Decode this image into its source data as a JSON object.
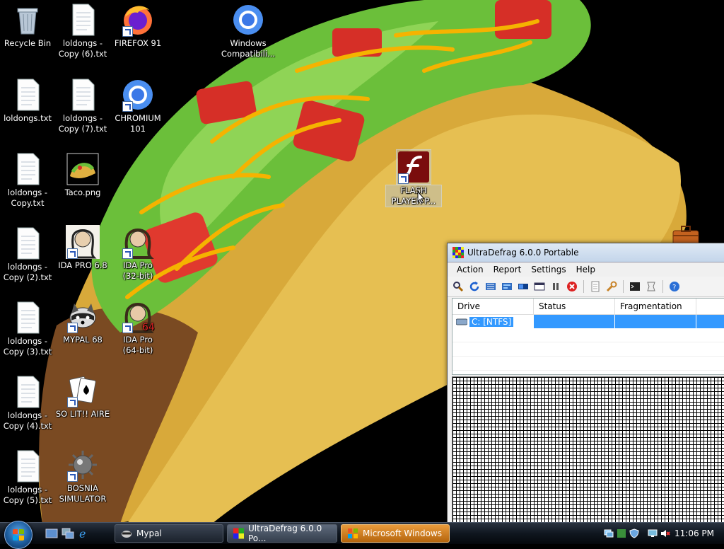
{
  "desktop": {
    "icons": [
      {
        "label": "Recycle Bin",
        "icon": "recycle-bin-icon"
      },
      {
        "label": "loldongs -\nCopy (6).txt",
        "icon": "text-file-icon"
      },
      {
        "label": "FIREFOX 91",
        "icon": "firefox-icon"
      },
      {
        "label": "Windows\nCompatibili...",
        "icon": "chromium-icon"
      },
      {
        "label": "loldongs.txt",
        "icon": "text-file-icon"
      },
      {
        "label": "loldongs -\nCopy (7).txt",
        "icon": "text-file-icon"
      },
      {
        "label": "CHROMIUM\n101",
        "icon": "chromium-icon"
      },
      {
        "label": "loldongs -\nCopy.txt",
        "icon": "text-file-icon"
      },
      {
        "label": "Taco.png",
        "icon": "taco-image-icon"
      },
      {
        "label": "FLASH\nPLAYER P...",
        "icon": "flash-player-icon"
      },
      {
        "label": "loldongs -\nCopy (2).txt",
        "icon": "text-file-icon"
      },
      {
        "label": "IDA PRO 6.8",
        "icon": "ida-pro-icon"
      },
      {
        "label": "IDA Pro\n(32-bit)",
        "icon": "ida-pro-icon"
      },
      {
        "label": "loldongs -\nCopy (3).txt",
        "icon": "text-file-icon"
      },
      {
        "label": "MYPAL 68",
        "icon": "mypal-raccoon-icon"
      },
      {
        "label": "IDA Pro\n(64-bit)",
        "icon": "ida-pro-icon"
      },
      {
        "label": "loldongs -\nCopy (4).txt",
        "icon": "text-file-icon"
      },
      {
        "label": "SO LIT!! AIRE",
        "icon": "solitaire-cards-icon"
      },
      {
        "label": "loldongs -\nCopy (5).txt",
        "icon": "text-file-icon"
      },
      {
        "label": "BOSNIA\nSIMULATOR",
        "icon": "mine-icon"
      }
    ]
  },
  "window": {
    "title": "UltraDefrag 6.0.0 Portable",
    "menu": [
      "Action",
      "Report",
      "Settings",
      "Help"
    ],
    "columns": [
      "Drive",
      "Status",
      "Fragmentation"
    ],
    "rows": [
      {
        "drive": "C: [NTFS]",
        "status": "",
        "fragmentation": ""
      }
    ],
    "toolbar_icons": [
      "analyze-icon",
      "refresh-icon",
      "defrag-icon",
      "optimize-icon",
      "mft-icon",
      "quick-optimize-icon",
      "pause-icon",
      "stop-icon",
      "report-icon",
      "settings-wrench-icon",
      "terminal-icon",
      "boot-icon",
      "help-icon"
    ]
  },
  "taskbar": {
    "tasks": [
      {
        "label": "Mypal",
        "icon": "mypal-raccoon-icon"
      },
      {
        "label": "UltraDefrag 6.0.0 Po...",
        "icon": "ultradefrag-icon"
      },
      {
        "label": "Microsoft Windows",
        "icon": "windows-flag-icon"
      }
    ],
    "clock": "11:06 PM"
  },
  "colors": {
    "selection": "#3399ff",
    "taskbar": "#0f161f",
    "flashing_task": "#d17f1f"
  }
}
